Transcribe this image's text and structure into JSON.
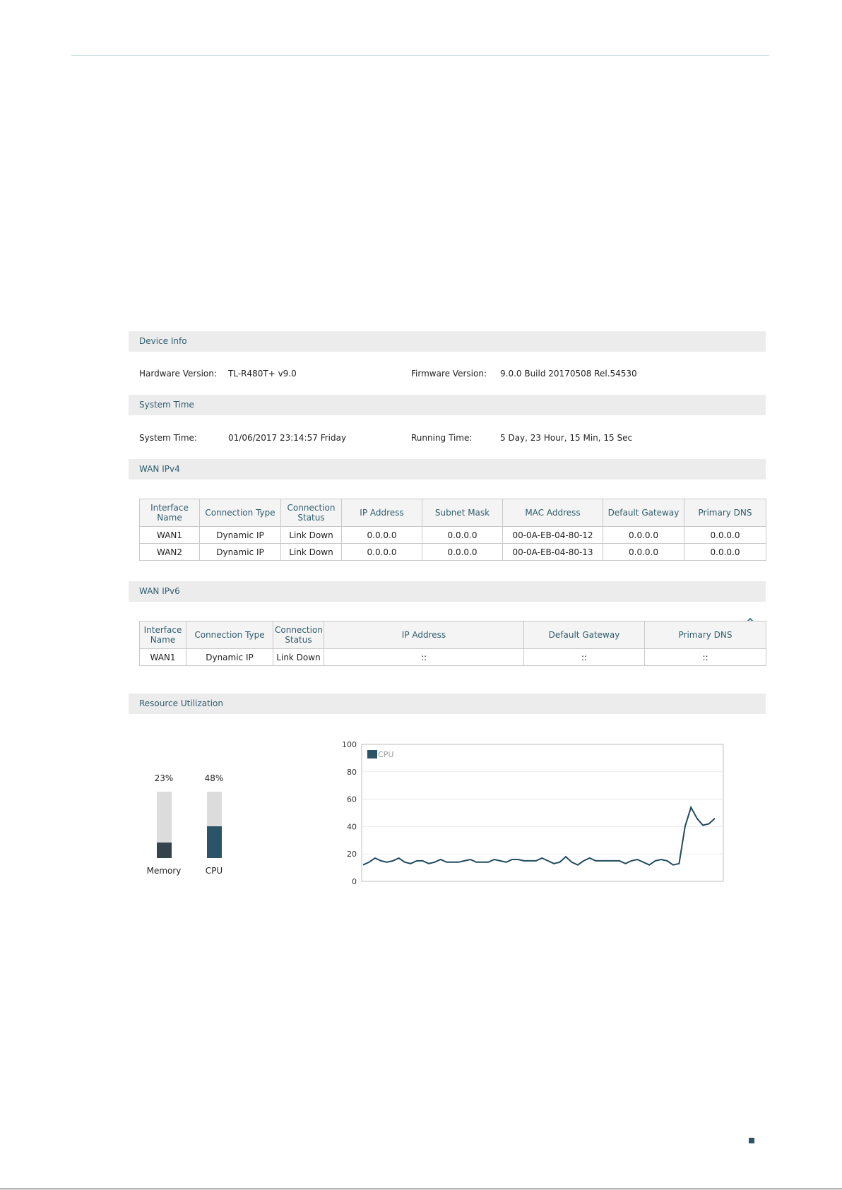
{
  "device_info": {
    "header": "Device Info",
    "hardware_label": "Hardware Version:",
    "hardware_value": "TL-R480T+ v9.0",
    "firmware_label": "Firmware Version:",
    "firmware_value": "9.0.0 Build 20170508 Rel.54530"
  },
  "system_time": {
    "header": "System Time",
    "time_label": "System Time:",
    "time_value": "01/06/2017 23:14:57 Friday",
    "running_label": "Running Time:",
    "running_value": "5 Day, 23 Hour, 15 Min, 15 Sec"
  },
  "wan_ipv4": {
    "header": "WAN IPv4",
    "columns": [
      "Interface Name",
      "Connection Type",
      "Connection Status",
      "IP Address",
      "Subnet Mask",
      "MAC Address",
      "Default Gateway",
      "Primary DNS"
    ],
    "rows": [
      [
        "WAN1",
        "Dynamic IP",
        "Link Down",
        "0.0.0.0",
        "0.0.0.0",
        "00-0A-EB-04-80-12",
        "0.0.0.0",
        "0.0.0.0"
      ],
      [
        "WAN2",
        "Dynamic IP",
        "Link Down",
        "0.0.0.0",
        "0.0.0.0",
        "00-0A-EB-04-80-13",
        "0.0.0.0",
        "0.0.0.0"
      ]
    ]
  },
  "wan_ipv6": {
    "header": "WAN IPv6",
    "columns": [
      "Interface Name",
      "Connection Type",
      "Connection Status",
      "IP Address",
      "Default Gateway",
      "Primary DNS"
    ],
    "rows": [
      [
        "WAN1",
        "Dynamic IP",
        "Link Down",
        "::",
        "::",
        "::"
      ]
    ]
  },
  "resource": {
    "header": "Resource Utilization",
    "memory_label": "Memory",
    "memory_percent_text": "23%",
    "memory_percent": 23,
    "cpu_label": "CPU",
    "cpu_percent_text": "48%",
    "cpu_percent": 48
  },
  "colors": {
    "memory_fill": "#34434c",
    "cpu_fill": "#2b5468",
    "header_text": "#2f5d6e",
    "line": "#1f4a5e"
  },
  "chart_data": {
    "type": "line",
    "legend": "CPU",
    "legend_position": "top-left",
    "ylim": [
      0,
      100
    ],
    "yticks": [
      0,
      20,
      40,
      60,
      80,
      100
    ],
    "grid": true,
    "series": [
      {
        "name": "CPU",
        "values": [
          12,
          14,
          17,
          15,
          14,
          15,
          17,
          14,
          13,
          15,
          15,
          13,
          14,
          16,
          14,
          14,
          14,
          15,
          16,
          14,
          14,
          14,
          16,
          15,
          14,
          16,
          16,
          15,
          15,
          15,
          17,
          15,
          13,
          14,
          18,
          14,
          12,
          15,
          17,
          15,
          15,
          15,
          15,
          15,
          13,
          15,
          16,
          14,
          12,
          15,
          16,
          15,
          12,
          13,
          40,
          54,
          46,
          41,
          42,
          46
        ]
      }
    ]
  }
}
